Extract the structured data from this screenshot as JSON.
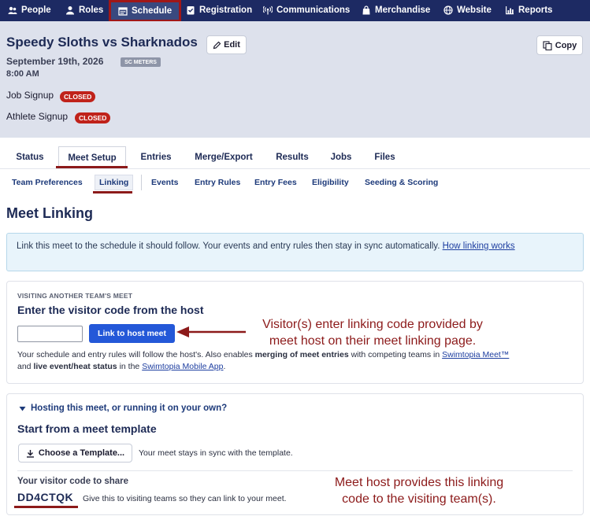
{
  "nav": {
    "items": [
      {
        "label": "People",
        "icon": "people-icon"
      },
      {
        "label": "Roles",
        "icon": "roles-icon"
      },
      {
        "label": "Schedule",
        "icon": "calendar-icon",
        "active": true
      },
      {
        "label": "Registration",
        "icon": "registration-icon"
      },
      {
        "label": "Communications",
        "icon": "broadcast-icon"
      },
      {
        "label": "Merchandise",
        "icon": "bag-icon"
      },
      {
        "label": "Website",
        "icon": "globe-icon"
      },
      {
        "label": "Reports",
        "icon": "bar-chart-icon"
      }
    ]
  },
  "meet": {
    "title": "Speedy Sloths vs Sharknados",
    "edit_label": "Edit",
    "copy_label": "Copy",
    "date": "September 19th, 2026",
    "course": "SC METERS",
    "time": "8:00 AM",
    "job_signup": "Job Signup",
    "athlete_signup": "Athlete Signup",
    "closed": "CLOSED"
  },
  "tabs": [
    "Status",
    "Meet Setup",
    "Entries",
    "Merge/Export",
    "Results",
    "Jobs",
    "Files"
  ],
  "subtabs": [
    "Team Preferences",
    "Linking",
    "Events",
    "Entry Rules",
    "Entry Fees",
    "Eligibility",
    "Seeding & Scoring"
  ],
  "page": {
    "title": "Meet Linking",
    "info_text": "Link this meet to the schedule it should follow. Your events and entry rules then stay in sync automatically.",
    "info_link": "How linking works"
  },
  "visiting": {
    "overline": "VISITING ANOTHER TEAM'S MEET",
    "heading": "Enter the visitor code from the host",
    "input_placeholder": "",
    "button": "Link to host meet",
    "helper_1": "Your schedule and entry rules will follow the host's. Also enables ",
    "helper_bold_1": "merging of meet entries",
    "helper_2": " with competing teams in ",
    "helper_link_1": "Swimtopia Meet™",
    "helper_3": "and ",
    "helper_bold_2": "live event/heat status",
    "helper_4": " in the ",
    "helper_link_2": "Swimtopia Mobile App",
    "helper_5": "."
  },
  "hosting": {
    "toggle": "Hosting this meet, or running it on your own?",
    "heading": "Start from a meet template",
    "template_button": "Choose a Template...",
    "template_note": "Your meet stays in sync with the template.",
    "share_label": "Your visitor code to share",
    "code": "DD4CTQK",
    "code_note": "Give this to visiting teams so they can link to your meet."
  },
  "annotations": {
    "visitor_line1": "Visitor(s) enter linking code provided by",
    "visitor_line2": "meet host on their meet linking page.",
    "host_line1": "Meet host provides this linking",
    "host_line2": "code to the visiting team(s)."
  },
  "colors": {
    "nav_bg": "#1d2a63",
    "header_bg": "#dde1ec",
    "accent": "#8c1a1a",
    "primary_button": "#2458d8",
    "closed_badge": "#c0221a"
  }
}
